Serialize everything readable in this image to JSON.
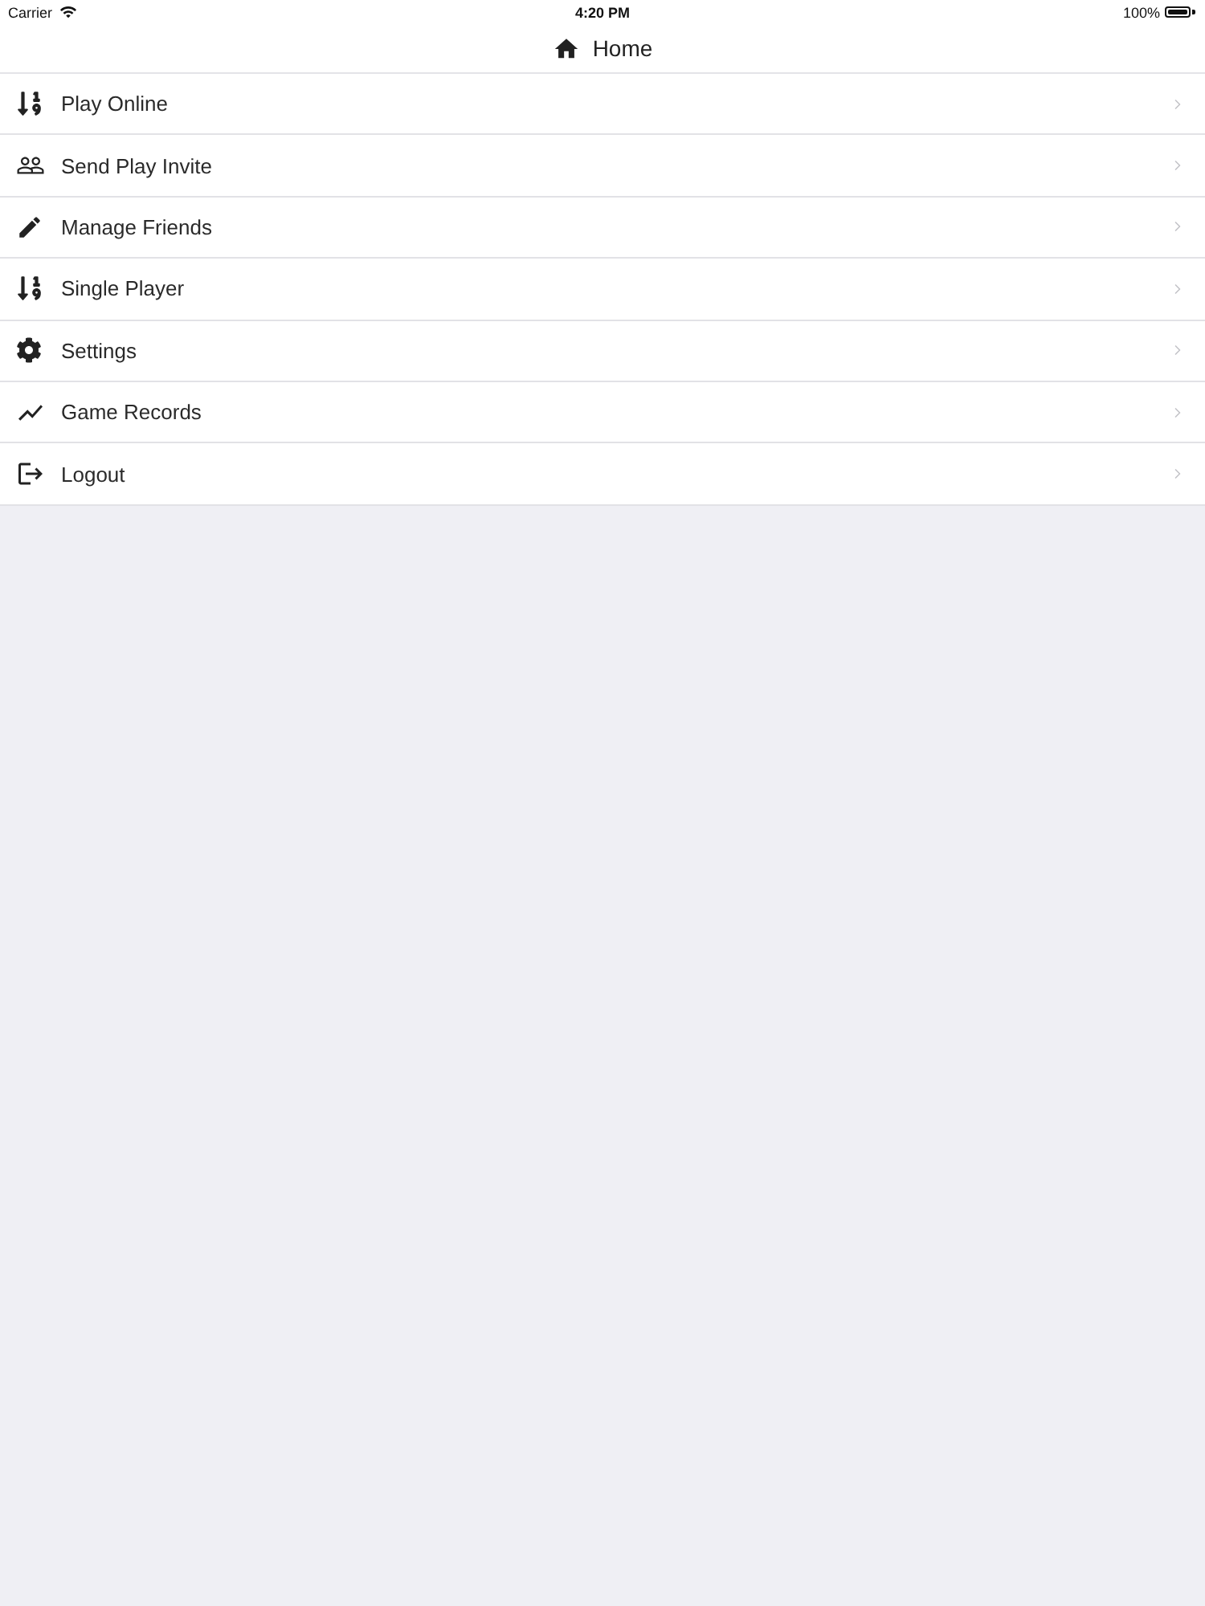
{
  "status_bar": {
    "carrier": "Carrier",
    "time": "4:20 PM",
    "battery": "100%"
  },
  "nav_bar": {
    "title": "Home"
  },
  "menu": {
    "items": [
      {
        "label": "Play Online"
      },
      {
        "label": "Send Play Invite"
      },
      {
        "label": "Manage Friends"
      },
      {
        "label": "Single Player"
      },
      {
        "label": "Settings"
      },
      {
        "label": "Game Records"
      },
      {
        "label": "Logout"
      }
    ]
  }
}
